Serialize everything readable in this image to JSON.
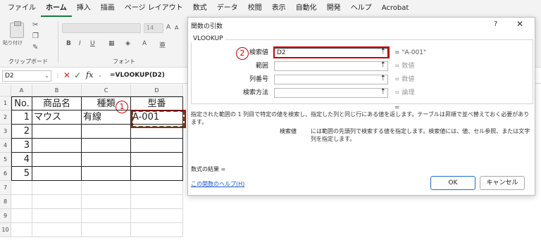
{
  "ribbon": {
    "tabs": [
      "ファイル",
      "ホーム",
      "挿入",
      "描画",
      "ページ レイアウト",
      "数式",
      "データ",
      "校閲",
      "表示",
      "自動化",
      "開発",
      "ヘルプ",
      "Acrobat"
    ],
    "active_tab": "ホーム",
    "paste_label": "貼り付け",
    "clipboard_group": "クリップボード",
    "font_group": "フォント",
    "font_size": "14"
  },
  "formula_bar": {
    "name_box": "D2",
    "fx": "fx",
    "formula": "=VLOOKUP(D2)"
  },
  "grid": {
    "columns": [
      "A",
      "B",
      "C",
      "D"
    ],
    "rows": [
      "1",
      "2",
      "3",
      "4",
      "5",
      "6",
      "7",
      "8",
      "9",
      "10"
    ],
    "header_row": [
      "No.",
      "商品名",
      "種類",
      "型番"
    ],
    "data_rows": [
      [
        "1",
        "マウス",
        "有線",
        "A-001"
      ],
      [
        "2",
        "",
        "",
        ""
      ],
      [
        "3",
        "",
        "",
        ""
      ],
      [
        "4",
        "",
        "",
        ""
      ],
      [
        "5",
        "",
        "",
        ""
      ]
    ]
  },
  "badges": {
    "one": "1",
    "two": "2"
  },
  "dialog": {
    "title": "関数の引数",
    "help": "?",
    "close": "✕",
    "function_name": "VLOOKUP",
    "args": [
      {
        "label": "検索値",
        "value": "D2",
        "result": "= \"A-001\""
      },
      {
        "label": "範囲",
        "value": "",
        "result": "= 数値"
      },
      {
        "label": "列番号",
        "value": "",
        "result": "= 数値"
      },
      {
        "label": "検索方法",
        "value": "",
        "result": "= 論理"
      }
    ],
    "equals": "=",
    "description": "指定された範囲の 1 列目で特定の値を検索し、指定した列と同じ行にある値を返します。テーブルは昇順で並べ替えておく必要があります。",
    "arg_desc_name": "検索値",
    "arg_desc": "には範囲の先頭列で検索する値を指定します。検索値には、値、セル参照、または文字列を指定します。",
    "result_label": "数式の結果 =",
    "help_link": "この関数のヘルプ(H)",
    "ok": "OK",
    "cancel": "キャンセル"
  },
  "colors": {
    "accent": "#1a7a3f",
    "highlight": "#d10000",
    "link": "#1a56c4"
  }
}
